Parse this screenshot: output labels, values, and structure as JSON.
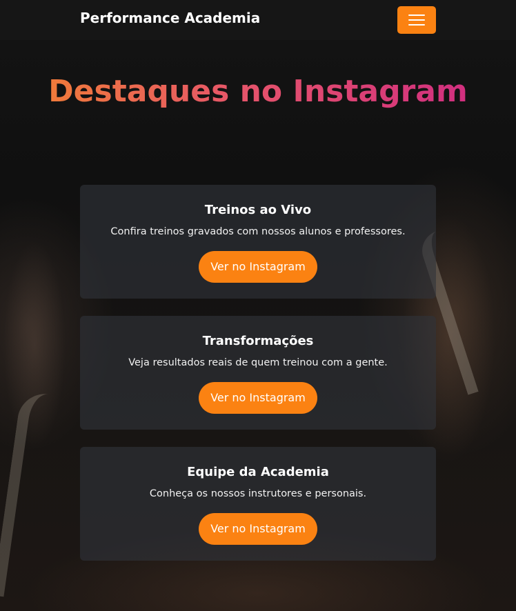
{
  "navbar": {
    "brand": "Performance Academia",
    "menu_toggle_icon": "hamburger-menu-icon",
    "toggle_color": "#fb8212"
  },
  "section": {
    "title": "Destaques no Instagram",
    "title_gradient": [
      "#f07a3a",
      "#e6556a",
      "#d12f7f"
    ]
  },
  "cards": [
    {
      "title": "Treinos ao Vivo",
      "description": "Confira treinos gravados com nossos alunos e professores.",
      "button_label": "Ver no Instagram"
    },
    {
      "title": "Transformações",
      "description": "Veja resultados reais de quem treinou com a gente.",
      "button_label": "Ver no Instagram"
    },
    {
      "title": "Equipe da Academia",
      "description": "Conheça os nossos instrutores e personais.",
      "button_label": "Ver no Instagram"
    }
  ],
  "accent_color": "#fb8212"
}
